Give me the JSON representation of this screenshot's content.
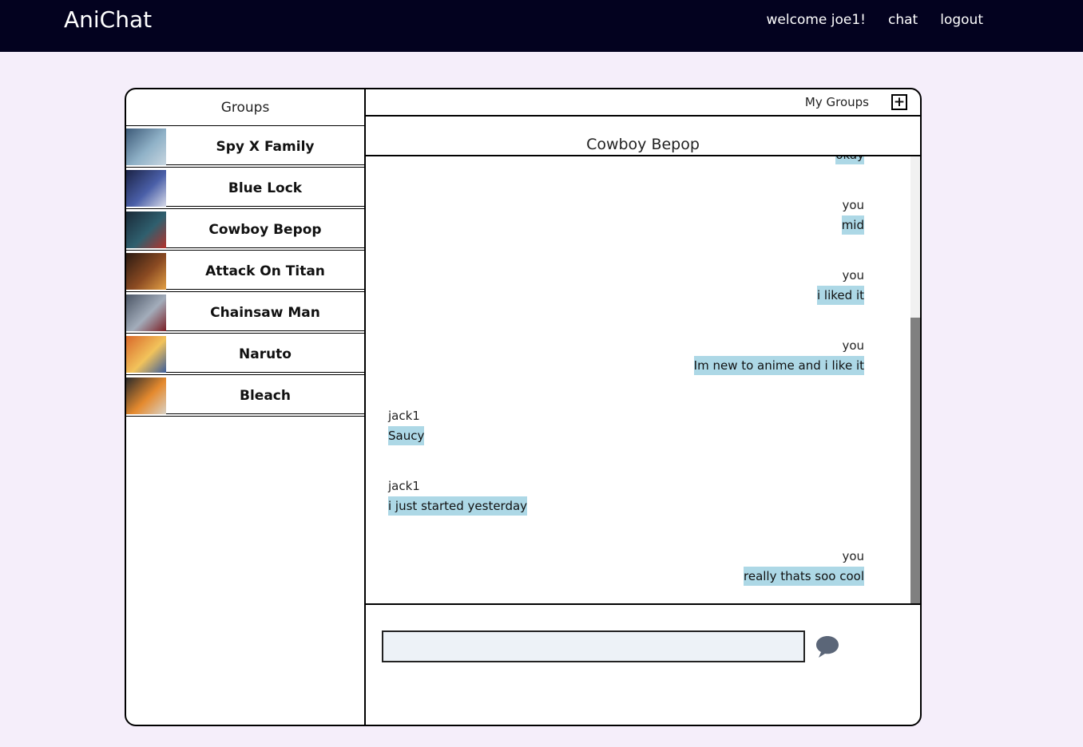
{
  "nav": {
    "brand": "AniChat",
    "welcome": "welcome joe1!",
    "chat": "chat",
    "logout": "logout"
  },
  "sidebar": {
    "title": "Groups",
    "groups": [
      {
        "name": "Spy X Family",
        "thumb_colors": [
          "#3d5a78",
          "#8fb1c7",
          "#c8d6e0"
        ]
      },
      {
        "name": "Blue Lock",
        "thumb_colors": [
          "#1b2346",
          "#4a5fa8",
          "#d8dbe9"
        ]
      },
      {
        "name": "Cowboy Bepop",
        "thumb_colors": [
          "#1a2a38",
          "#2f5f6e",
          "#b4322b"
        ]
      },
      {
        "name": "Attack On Titan",
        "thumb_colors": [
          "#2b1a12",
          "#8a4a22",
          "#e3a045"
        ]
      },
      {
        "name": "Chainsaw Man",
        "thumb_colors": [
          "#4b5565",
          "#a3adbb",
          "#7b1e24"
        ]
      },
      {
        "name": "Naruto",
        "thumb_colors": [
          "#d9682a",
          "#f2c35b",
          "#3b5d9c"
        ]
      },
      {
        "name": "Bleach",
        "thumb_colors": [
          "#2a2a2a",
          "#e58a2e",
          "#d9d2c6"
        ]
      }
    ]
  },
  "chat": {
    "my_groups": "My Groups",
    "add_label": "+",
    "title": "Cowboy Bepop",
    "messages": [
      {
        "sender": "",
        "text": "okay",
        "side": "right"
      },
      {
        "sender": "you",
        "text": "mid",
        "side": "right"
      },
      {
        "sender": "you",
        "text": "i liked it",
        "side": "right"
      },
      {
        "sender": "you",
        "text": "Im new to anime and i like it",
        "side": "right"
      },
      {
        "sender": "jack1",
        "text": "Saucy",
        "side": "left"
      },
      {
        "sender": "jack1",
        "text": "i just started yesterday",
        "side": "left"
      },
      {
        "sender": "you",
        "text": "really thats soo cool",
        "side": "right"
      }
    ],
    "input_value": "",
    "input_placeholder": ""
  },
  "colors": {
    "nav_bg": "#03021f",
    "page_bg": "#f5eefa",
    "bubble": "#add8e6",
    "send_icon": "#5b6678"
  }
}
